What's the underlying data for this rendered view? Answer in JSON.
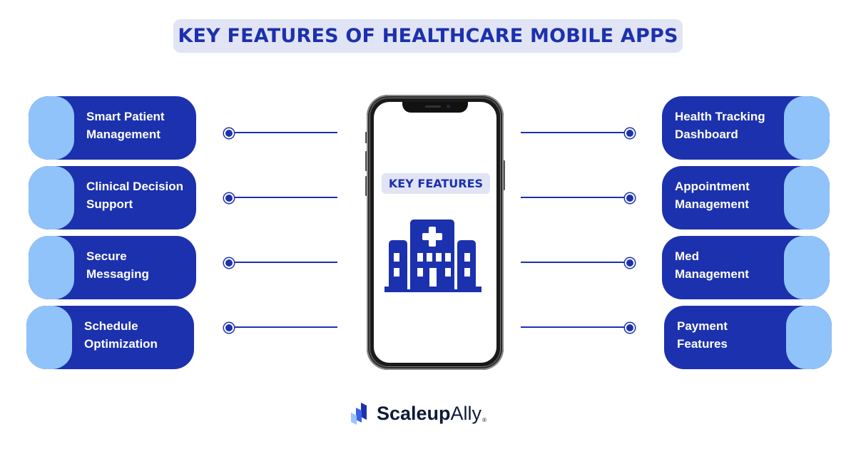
{
  "title": "KEY FEATURES OF HEALTHCARE MOBILE APPS",
  "phone": {
    "badge": "KEY FEATURES",
    "icon": "hospital-icon"
  },
  "left_features": [
    {
      "line1": "Smart Patient",
      "line2": "Management"
    },
    {
      "line1": "Clinical Decision",
      "line2": "Support"
    },
    {
      "line1": "Secure",
      "line2": "Messaging"
    },
    {
      "line1": "Schedule",
      "line2": "Optimization"
    }
  ],
  "right_features": [
    {
      "line1": "Health Tracking",
      "line2": "Dashboard"
    },
    {
      "line1": "Appointment",
      "line2": "Management"
    },
    {
      "line1": "Med",
      "line2": "Management"
    },
    {
      "line1": "Payment",
      "line2": "Features"
    }
  ],
  "brand": {
    "name_bold": "Scaleup",
    "name_regular": "Ally",
    "registered": "®",
    "icon": "scaleupally-logo-icon"
  },
  "colors": {
    "primary": "#1c31ad",
    "accent_light": "#91c3fb",
    "title_bg": "#e1e4f4"
  }
}
